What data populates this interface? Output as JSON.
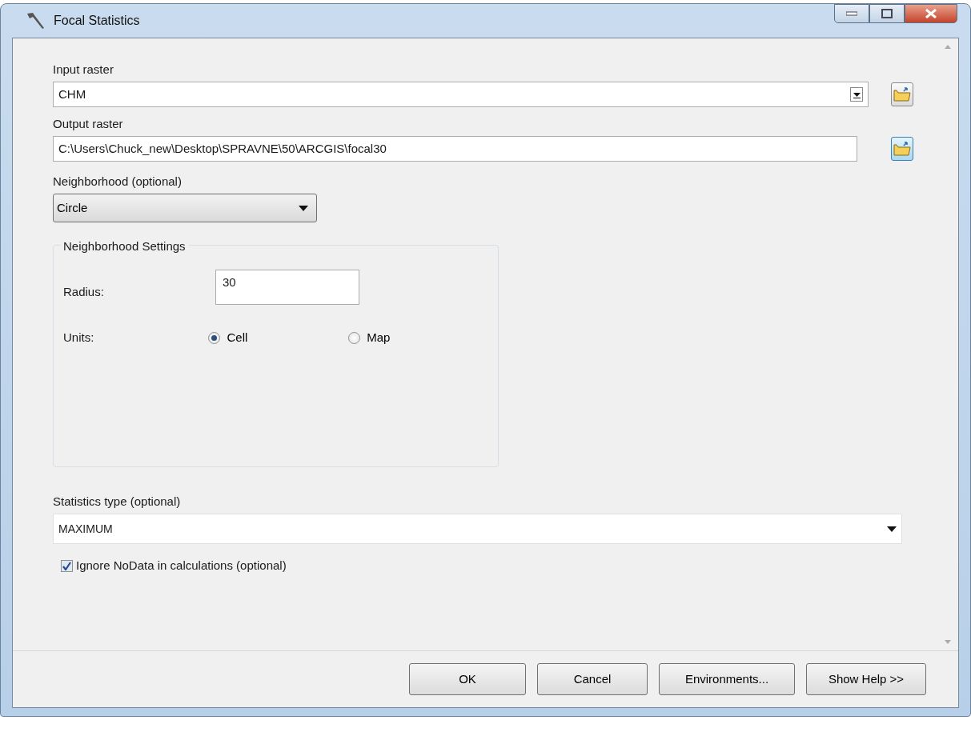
{
  "window": {
    "title": "Focal Statistics"
  },
  "input_raster": {
    "label": "Input raster",
    "value": "CHM"
  },
  "output_raster": {
    "label": "Output raster",
    "value": "C:\\Users\\Chuck_new\\Desktop\\SPRAVNE\\50\\ARCGIS\\focal30"
  },
  "neighborhood": {
    "label": "Neighborhood (optional)",
    "value": "Circle"
  },
  "neighborhood_settings": {
    "title": "Neighborhood Settings",
    "radius_label": "Radius:",
    "radius": "30",
    "units_label": "Units:",
    "units": [
      {
        "label": "Cell",
        "selected": true
      },
      {
        "label": "Map",
        "selected": false
      }
    ]
  },
  "statistics_type": {
    "label": "Statistics type (optional)",
    "value": "MAXIMUM"
  },
  "ignore_nodata": {
    "label": "Ignore NoData in calculations (optional)",
    "checked": true
  },
  "buttons": [
    "OK",
    "Cancel",
    "Environments...",
    "Show Help >>"
  ]
}
